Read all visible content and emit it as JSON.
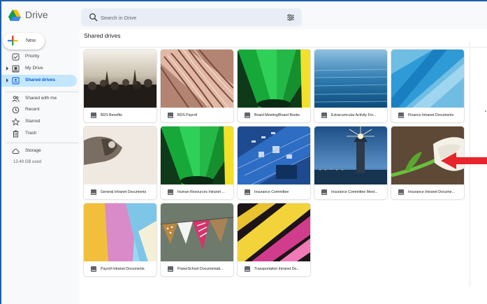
{
  "app": {
    "name": "Drive"
  },
  "search": {
    "placeholder": "Search in Drive"
  },
  "sidebar": {
    "new_label": "New",
    "items": [
      {
        "label": "Priority",
        "icon": "check-circle-icon",
        "active": false
      },
      {
        "label": "My Drive",
        "icon": "my-drive-icon",
        "active": false
      },
      {
        "label": "Shared drives",
        "icon": "shared-drives-icon",
        "active": true
      },
      {
        "label": "Shared with me",
        "icon": "people-icon",
        "active": false
      },
      {
        "label": "Recent",
        "icon": "clock-icon",
        "active": false
      },
      {
        "label": "Starred",
        "icon": "star-icon",
        "active": false
      },
      {
        "label": "Trash",
        "icon": "trash-icon",
        "active": false
      },
      {
        "label": "Storage",
        "icon": "cloud-icon",
        "active": false
      }
    ],
    "storage_used": "13.49 GB used"
  },
  "main": {
    "title": "Shared drives",
    "drives": [
      {
        "name": "BDS Benefits",
        "thumb": "concert"
      },
      {
        "name": "BDS Payroll",
        "thumb": "shell"
      },
      {
        "name": "Board Meeting/Board Books",
        "thumb": "green-pencil"
      },
      {
        "name": "Extracurricular Activity For...",
        "thumb": "water"
      },
      {
        "name": "Finance Intranet Documents",
        "thumb": "blue-paper"
      },
      {
        "name": "General Intranet Documents",
        "thumb": "hand"
      },
      {
        "name": "Human Resources Intranet ...",
        "thumb": "green-pencil"
      },
      {
        "name": "Insurance Committee",
        "thumb": "circuit"
      },
      {
        "name": "Insurance Committee Meet...",
        "thumb": "lighthouse"
      },
      {
        "name": "Insurance Intranet Docume...",
        "thumb": "tulip"
      },
      {
        "name": "Payroll Intranet Documents",
        "thumb": "notes"
      },
      {
        "name": "PowerSchool Documentati...",
        "thumb": "bunting"
      },
      {
        "name": "Transportation Intranet Do...",
        "thumb": "papers"
      }
    ]
  },
  "colors": {
    "accent": "#0b57d0",
    "active_bg": "#c2e7ff",
    "annotation_arrow": "#e8242c"
  }
}
